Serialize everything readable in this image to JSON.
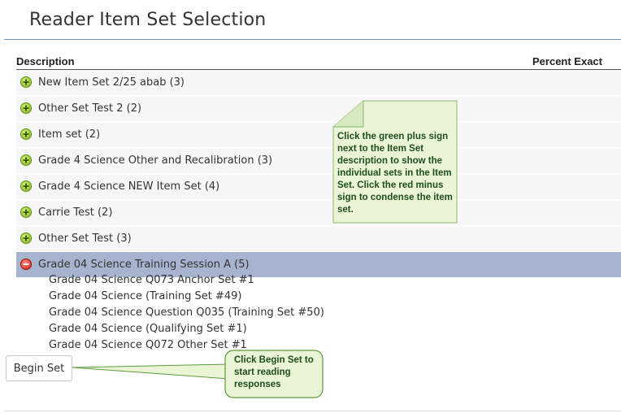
{
  "page": {
    "title": "Reader Item Set Selection"
  },
  "table": {
    "headers": {
      "description": "Description",
      "percent_exact": "Percent Exact"
    },
    "rows": [
      {
        "label": "New Item Set 2/25 abab (3)",
        "state": "collapsed"
      },
      {
        "label": "Other Set Test 2 (2)",
        "state": "collapsed"
      },
      {
        "label": "Item set (2)",
        "state": "collapsed"
      },
      {
        "label": "Grade 4 Science Other and Recalibration (3)",
        "state": "collapsed"
      },
      {
        "label": "Grade 4 Science NEW Item Set (4)",
        "state": "collapsed"
      },
      {
        "label": "Carrie Test (2)",
        "state": "collapsed"
      },
      {
        "label": "Other Set Test (3)",
        "state": "collapsed"
      },
      {
        "label": "Grade 04 Science Training Session A (5)",
        "state": "expanded"
      }
    ],
    "expanded_subsets": [
      "Grade 04 Science Q073 Anchor Set #1",
      "Grade 04 Science (Training Set #49)",
      "Grade 04 Science Question Q035 (Training Set #50)",
      "Grade 04 Science (Qualifying Set #1)",
      "Grade 04 Science Q072 Other Set #1"
    ]
  },
  "actions": {
    "begin_set": "Begin Set"
  },
  "callouts": {
    "expand_help": "Click the green plus sign next to the Item Set description to show the individual sets in the Item Set. Click the red minus sign to condense the item set.",
    "begin_help": "Click Begin Set to start reading responses"
  },
  "colors": {
    "selected_row": "#a6b4cf",
    "row_bg": "#f7f7f7",
    "callout_fill": "#eaf5d6",
    "callout_border": "#5d9a3c",
    "plus_icon": "#7ab51d",
    "minus_icon": "#d0201a"
  }
}
